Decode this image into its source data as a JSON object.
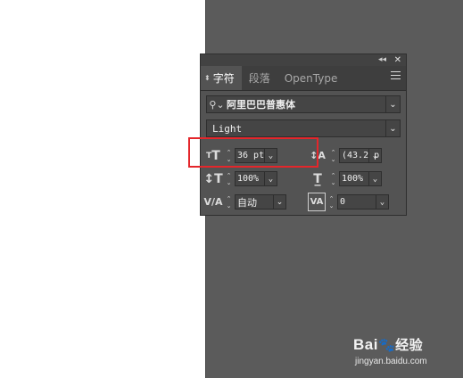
{
  "panel": {
    "tabs": [
      {
        "label": "字符",
        "active": true
      },
      {
        "label": "段落",
        "active": false
      },
      {
        "label": "OpenType",
        "active": false
      }
    ],
    "font_family": "阿里巴巴普惠体",
    "font_style": "Light",
    "font_size": "36 pt",
    "leading": "(43.2 p",
    "vertical_scale": "100%",
    "horizontal_scale": "100%",
    "kerning": "自动",
    "tracking": "0"
  },
  "watermark": {
    "brand_prefix": "Bai",
    "brand_paw": "🐾",
    "brand_suffix": "经验",
    "url": "jingyan.baidu.com"
  },
  "colors": {
    "panel_bg": "#535353",
    "pasteboard_bg": "#5b5b5b",
    "highlight_red": "#e4262b"
  }
}
